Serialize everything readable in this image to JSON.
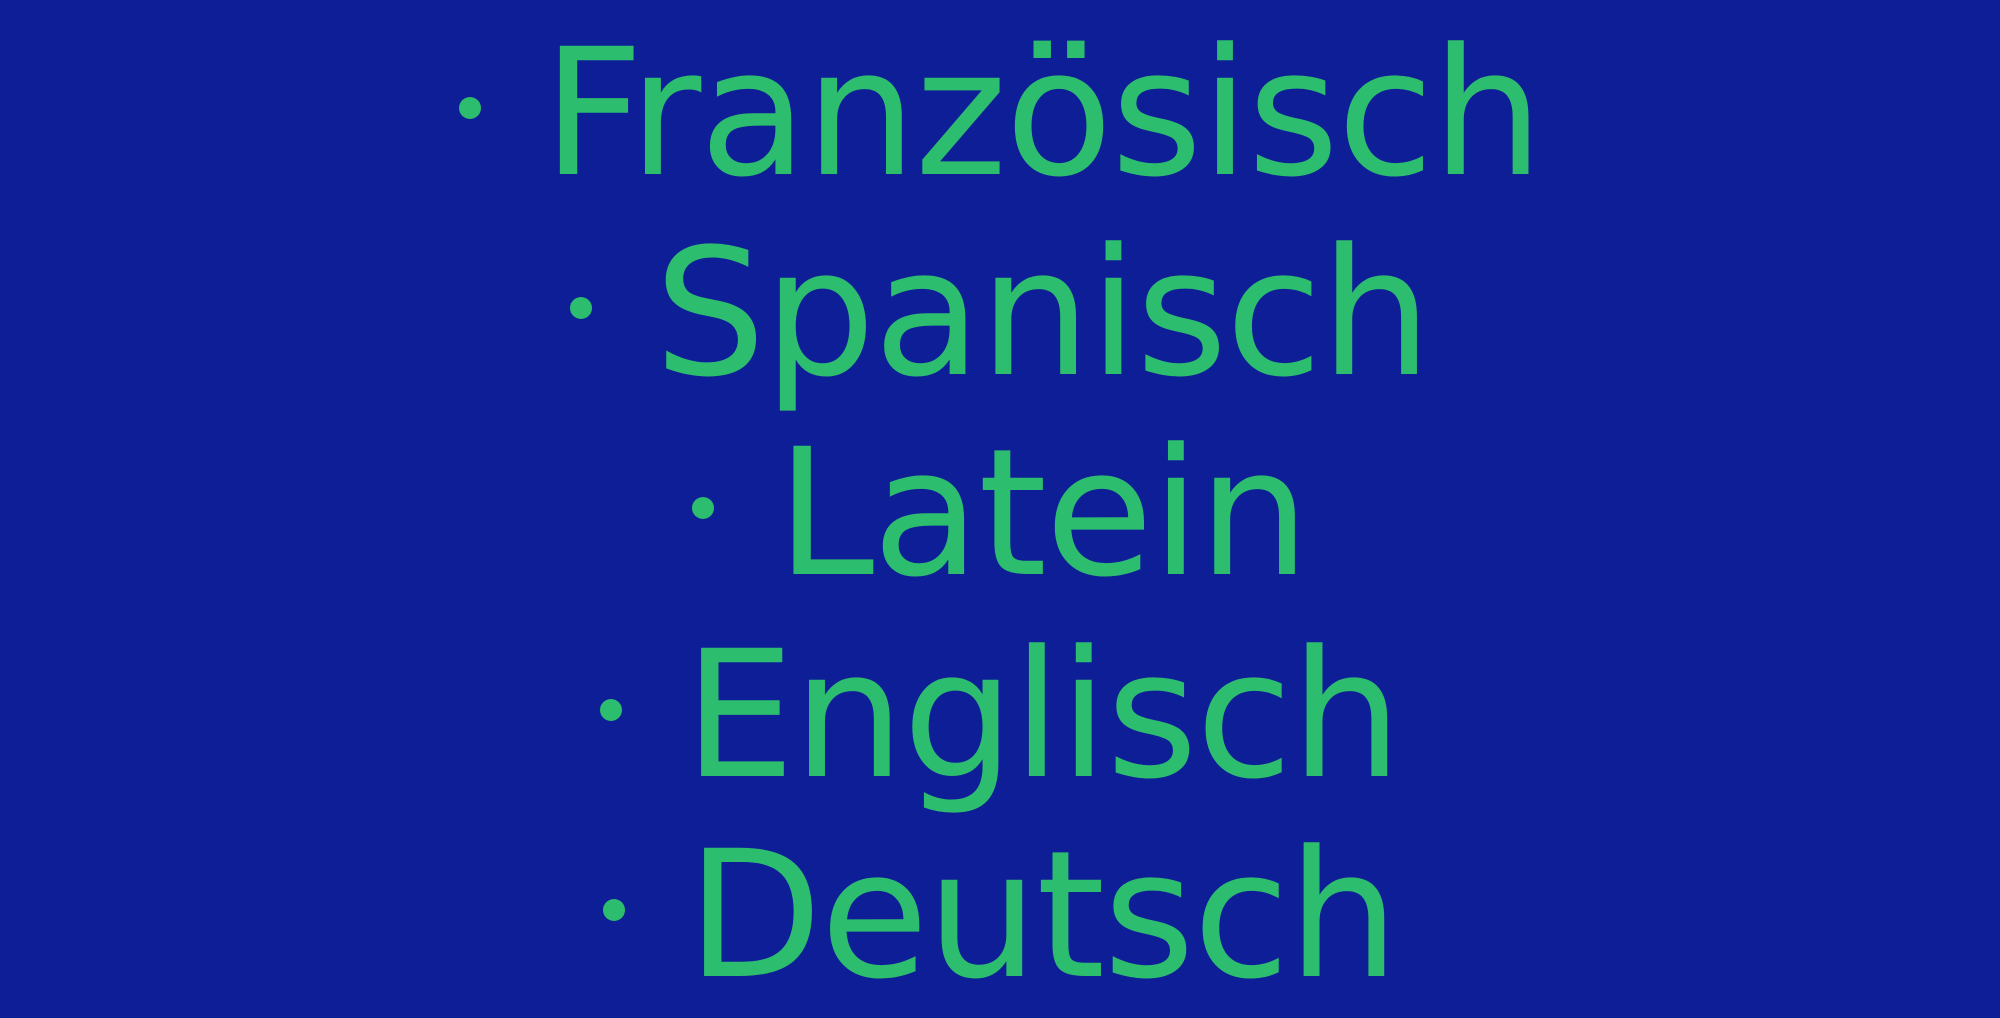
{
  "languages": [
    {
      "label": "Französisch"
    },
    {
      "label": "Spanisch"
    },
    {
      "label": "Latein"
    },
    {
      "label": "Englisch"
    },
    {
      "label": "Deutsch"
    }
  ],
  "colors": {
    "background": "#0e1e96",
    "text": "#2dbd6e"
  },
  "icons": {
    "bullet": "bullet-dot"
  }
}
